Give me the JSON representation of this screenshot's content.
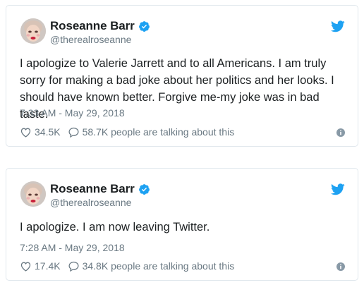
{
  "tweets": [
    {
      "name": "Roseanne Barr",
      "handle": "@therealroseanne",
      "text": "I apologize to Valerie Jarrett and to all Americans. I am truly sorry for making a bad joke about her politics and her looks. I should have known better. Forgive me-my joke was in bad taste.",
      "timestamp": "7:33 AM - May 29, 2018",
      "likes": "34.5K",
      "talking": "58.7K people are talking about this"
    },
    {
      "name": "Roseanne Barr",
      "handle": "@therealroseanne",
      "text": "I apologize. I am now leaving Twitter.",
      "timestamp": "7:28 AM - May 29, 2018",
      "likes": "17.4K",
      "talking": "34.8K people are talking about this"
    }
  ],
  "icons": {
    "verified": "verified-badge-icon",
    "brand": "twitter-bird-icon",
    "like": "heart-icon",
    "reply": "speech-bubble-icon",
    "info": "info-icon"
  },
  "colors": {
    "twitter_blue": "#1da1f2",
    "secondary_text": "#697882",
    "border": "#e1e8ed"
  }
}
